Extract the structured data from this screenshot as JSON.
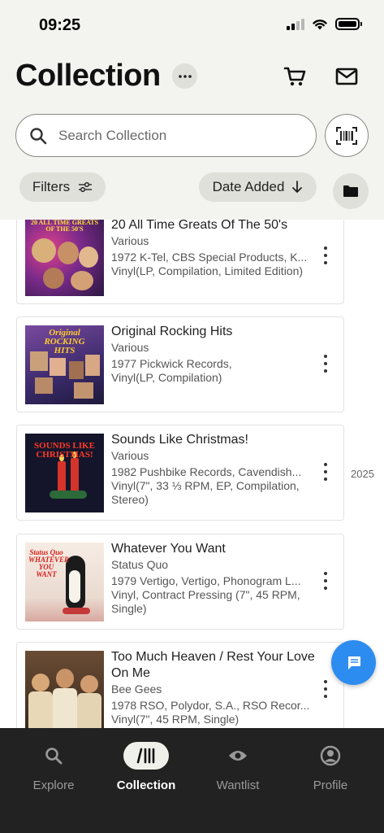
{
  "status_bar": {
    "time": "09:25"
  },
  "header": {
    "title": "Collection",
    "search_placeholder": "Search Collection",
    "filters_label": "Filters",
    "sort_label": "Date Added"
  },
  "releases": [
    {
      "title": "20 All Time Greats Of The 50's",
      "artist": "Various",
      "label": "1972 K-Tel, CBS Special Products, K...",
      "format": "Vinyl(LP, Compilation, Limited Edition)",
      "cover_text": "20 ALL TIME GREATS OF THE 50'S"
    },
    {
      "title": "Original Rocking Hits",
      "artist": "Various",
      "label": "1977 Pickwick Records,",
      "format": "Vinyl(LP, Compilation)",
      "cover_text": "Original ROCKING HITS"
    },
    {
      "title": "Sounds Like Christmas!",
      "artist": "Various",
      "label": "1982 Pushbike Records, Cavendish...",
      "format": "Vinyl(7\", 33 ⅓ RPM, EP, Compilation, Stereo)",
      "cover_text": "SOUNDS LIKE CHRISTMAS!"
    },
    {
      "title": "Whatever You Want",
      "artist": "Status Quo",
      "label": "1979 Vertigo, Vertigo, Phonogram L...",
      "format": "Vinyl, Contract Pressing (7\", 45 RPM, Single)",
      "cover_text": "Status Quo WHATEVER YOU WANT"
    },
    {
      "title": "Too Much Heaven / Rest Your Love On Me",
      "artist": "Bee Gees",
      "label": "1978 RSO, Polydor, S.A., RSO Recor...",
      "format": "Vinyl(7\", 45 RPM, Single)",
      "cover_text": ""
    }
  ],
  "year_marker": "2025",
  "bottom_nav": {
    "items": [
      {
        "label": "Explore",
        "icon": "search-icon",
        "active": false
      },
      {
        "label": "Collection",
        "icon": "collection-icon",
        "active": true
      },
      {
        "label": "Wantlist",
        "icon": "eye-icon",
        "active": false
      },
      {
        "label": "Profile",
        "icon": "profile-icon",
        "active": false
      }
    ]
  },
  "colors": {
    "header_bg": "#f3f3ef",
    "pill_bg": "#e0e0db",
    "fab": "#2d8cf0",
    "nav_bg": "#222222"
  }
}
